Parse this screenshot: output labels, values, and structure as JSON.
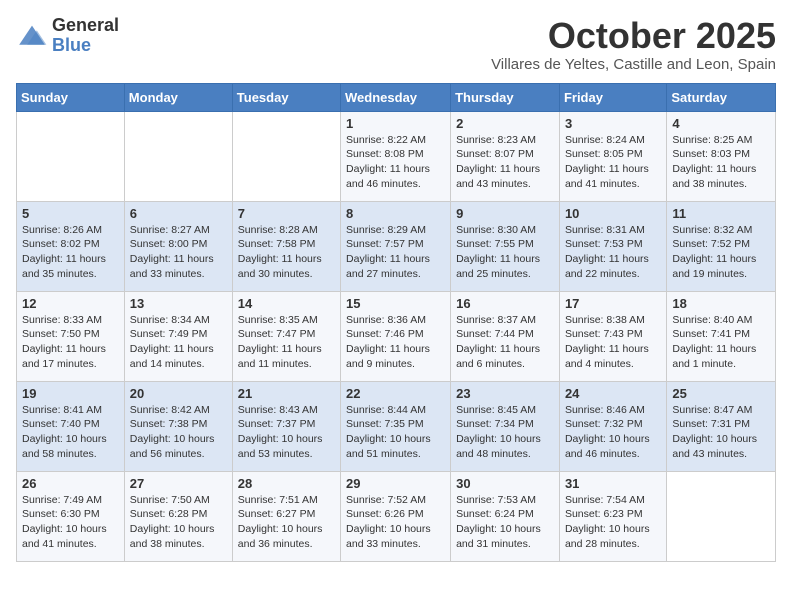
{
  "header": {
    "logo_general": "General",
    "logo_blue": "Blue",
    "month_title": "October 2025",
    "subtitle": "Villares de Yeltes, Castille and Leon, Spain"
  },
  "columns": [
    "Sunday",
    "Monday",
    "Tuesday",
    "Wednesday",
    "Thursday",
    "Friday",
    "Saturday"
  ],
  "weeks": [
    [
      {
        "day": "",
        "info": ""
      },
      {
        "day": "",
        "info": ""
      },
      {
        "day": "",
        "info": ""
      },
      {
        "day": "1",
        "info": "Sunrise: 8:22 AM\nSunset: 8:08 PM\nDaylight: 11 hours and 46 minutes."
      },
      {
        "day": "2",
        "info": "Sunrise: 8:23 AM\nSunset: 8:07 PM\nDaylight: 11 hours and 43 minutes."
      },
      {
        "day": "3",
        "info": "Sunrise: 8:24 AM\nSunset: 8:05 PM\nDaylight: 11 hours and 41 minutes."
      },
      {
        "day": "4",
        "info": "Sunrise: 8:25 AM\nSunset: 8:03 PM\nDaylight: 11 hours and 38 minutes."
      }
    ],
    [
      {
        "day": "5",
        "info": "Sunrise: 8:26 AM\nSunset: 8:02 PM\nDaylight: 11 hours and 35 minutes."
      },
      {
        "day": "6",
        "info": "Sunrise: 8:27 AM\nSunset: 8:00 PM\nDaylight: 11 hours and 33 minutes."
      },
      {
        "day": "7",
        "info": "Sunrise: 8:28 AM\nSunset: 7:58 PM\nDaylight: 11 hours and 30 minutes."
      },
      {
        "day": "8",
        "info": "Sunrise: 8:29 AM\nSunset: 7:57 PM\nDaylight: 11 hours and 27 minutes."
      },
      {
        "day": "9",
        "info": "Sunrise: 8:30 AM\nSunset: 7:55 PM\nDaylight: 11 hours and 25 minutes."
      },
      {
        "day": "10",
        "info": "Sunrise: 8:31 AM\nSunset: 7:53 PM\nDaylight: 11 hours and 22 minutes."
      },
      {
        "day": "11",
        "info": "Sunrise: 8:32 AM\nSunset: 7:52 PM\nDaylight: 11 hours and 19 minutes."
      }
    ],
    [
      {
        "day": "12",
        "info": "Sunrise: 8:33 AM\nSunset: 7:50 PM\nDaylight: 11 hours and 17 minutes."
      },
      {
        "day": "13",
        "info": "Sunrise: 8:34 AM\nSunset: 7:49 PM\nDaylight: 11 hours and 14 minutes."
      },
      {
        "day": "14",
        "info": "Sunrise: 8:35 AM\nSunset: 7:47 PM\nDaylight: 11 hours and 11 minutes."
      },
      {
        "day": "15",
        "info": "Sunrise: 8:36 AM\nSunset: 7:46 PM\nDaylight: 11 hours and 9 minutes."
      },
      {
        "day": "16",
        "info": "Sunrise: 8:37 AM\nSunset: 7:44 PM\nDaylight: 11 hours and 6 minutes."
      },
      {
        "day": "17",
        "info": "Sunrise: 8:38 AM\nSunset: 7:43 PM\nDaylight: 11 hours and 4 minutes."
      },
      {
        "day": "18",
        "info": "Sunrise: 8:40 AM\nSunset: 7:41 PM\nDaylight: 11 hours and 1 minute."
      }
    ],
    [
      {
        "day": "19",
        "info": "Sunrise: 8:41 AM\nSunset: 7:40 PM\nDaylight: 10 hours and 58 minutes."
      },
      {
        "day": "20",
        "info": "Sunrise: 8:42 AM\nSunset: 7:38 PM\nDaylight: 10 hours and 56 minutes."
      },
      {
        "day": "21",
        "info": "Sunrise: 8:43 AM\nSunset: 7:37 PM\nDaylight: 10 hours and 53 minutes."
      },
      {
        "day": "22",
        "info": "Sunrise: 8:44 AM\nSunset: 7:35 PM\nDaylight: 10 hours and 51 minutes."
      },
      {
        "day": "23",
        "info": "Sunrise: 8:45 AM\nSunset: 7:34 PM\nDaylight: 10 hours and 48 minutes."
      },
      {
        "day": "24",
        "info": "Sunrise: 8:46 AM\nSunset: 7:32 PM\nDaylight: 10 hours and 46 minutes."
      },
      {
        "day": "25",
        "info": "Sunrise: 8:47 AM\nSunset: 7:31 PM\nDaylight: 10 hours and 43 minutes."
      }
    ],
    [
      {
        "day": "26",
        "info": "Sunrise: 7:49 AM\nSunset: 6:30 PM\nDaylight: 10 hours and 41 minutes."
      },
      {
        "day": "27",
        "info": "Sunrise: 7:50 AM\nSunset: 6:28 PM\nDaylight: 10 hours and 38 minutes."
      },
      {
        "day": "28",
        "info": "Sunrise: 7:51 AM\nSunset: 6:27 PM\nDaylight: 10 hours and 36 minutes."
      },
      {
        "day": "29",
        "info": "Sunrise: 7:52 AM\nSunset: 6:26 PM\nDaylight: 10 hours and 33 minutes."
      },
      {
        "day": "30",
        "info": "Sunrise: 7:53 AM\nSunset: 6:24 PM\nDaylight: 10 hours and 31 minutes."
      },
      {
        "day": "31",
        "info": "Sunrise: 7:54 AM\nSunset: 6:23 PM\nDaylight: 10 hours and 28 minutes."
      },
      {
        "day": "",
        "info": ""
      }
    ]
  ]
}
